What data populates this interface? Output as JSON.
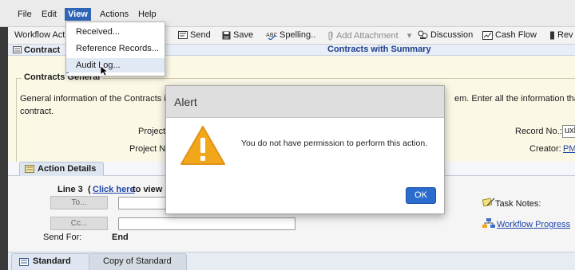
{
  "menubar": {
    "items": [
      "File",
      "Edit",
      "View",
      "Actions",
      "Help"
    ]
  },
  "view_menu": {
    "items": [
      "Received...",
      "Reference Records...",
      "Audit Log..."
    ]
  },
  "toolbar": {
    "workflow_actions": "Workflow Act",
    "send": "Send",
    "save": "Save",
    "spelling": "Spelling..",
    "add_attachment": "Add Attachment",
    "discussion": "Discussion",
    "cash_flow": "Cash Flow",
    "rev": "Rev"
  },
  "form": {
    "tab_label": "Contract",
    "heading": "Contracts with Summary",
    "section_title": "Contracts General",
    "desc_part1": "General information of the Contracts in",
    "desc_part2": "em. Enter all the information that",
    "desc_line2": "contract.",
    "project_label": "Project",
    "project_n_label": "Project N",
    "record_no_label": "Record No.:",
    "record_no_value": "uxl",
    "creator_label": "Creator:",
    "creator_value": "PM"
  },
  "action_details": {
    "tab": "Action Details",
    "line_prefix": "Line 3",
    "click_here": "Click here",
    "view_suffix": "to view l",
    "open_paren": "(",
    "to_button": "To...",
    "cc_button": "Cc...",
    "send_for_label": "Send For:",
    "send_for_value": "End",
    "task_notes": "Task Notes:",
    "workflow_progress": "Workflow Progress"
  },
  "bottom_tabs": [
    "Standard",
    "Copy of Standard"
  ],
  "alert": {
    "title": "Alert",
    "message": "You do not have permission to perform this action.",
    "ok": "OK"
  },
  "colors": {
    "menu_active": "#2f64b6",
    "ok_button": "#2c6ccf",
    "warning": "#f2a71b",
    "link": "#1f45a8",
    "form_background": "#fbf8e6"
  }
}
